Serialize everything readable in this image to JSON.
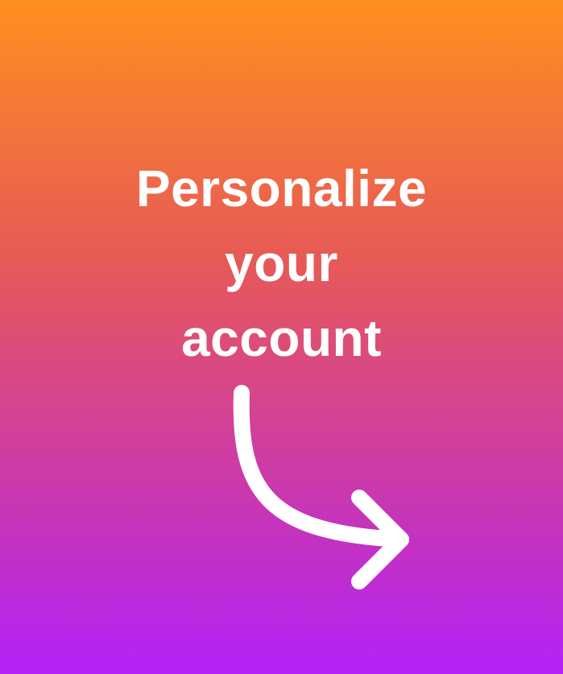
{
  "card": {
    "headline_lines": [
      "Personalize",
      "your",
      "account"
    ],
    "arrow_icon": "curved-arrow-right-icon",
    "colors": {
      "gradient_top": "#FF8F1F",
      "gradient_mid": "#E75A56",
      "gradient_low": "#CE3CA3",
      "gradient_bottom": "#B321F6",
      "text": "#FFFFFF"
    }
  }
}
